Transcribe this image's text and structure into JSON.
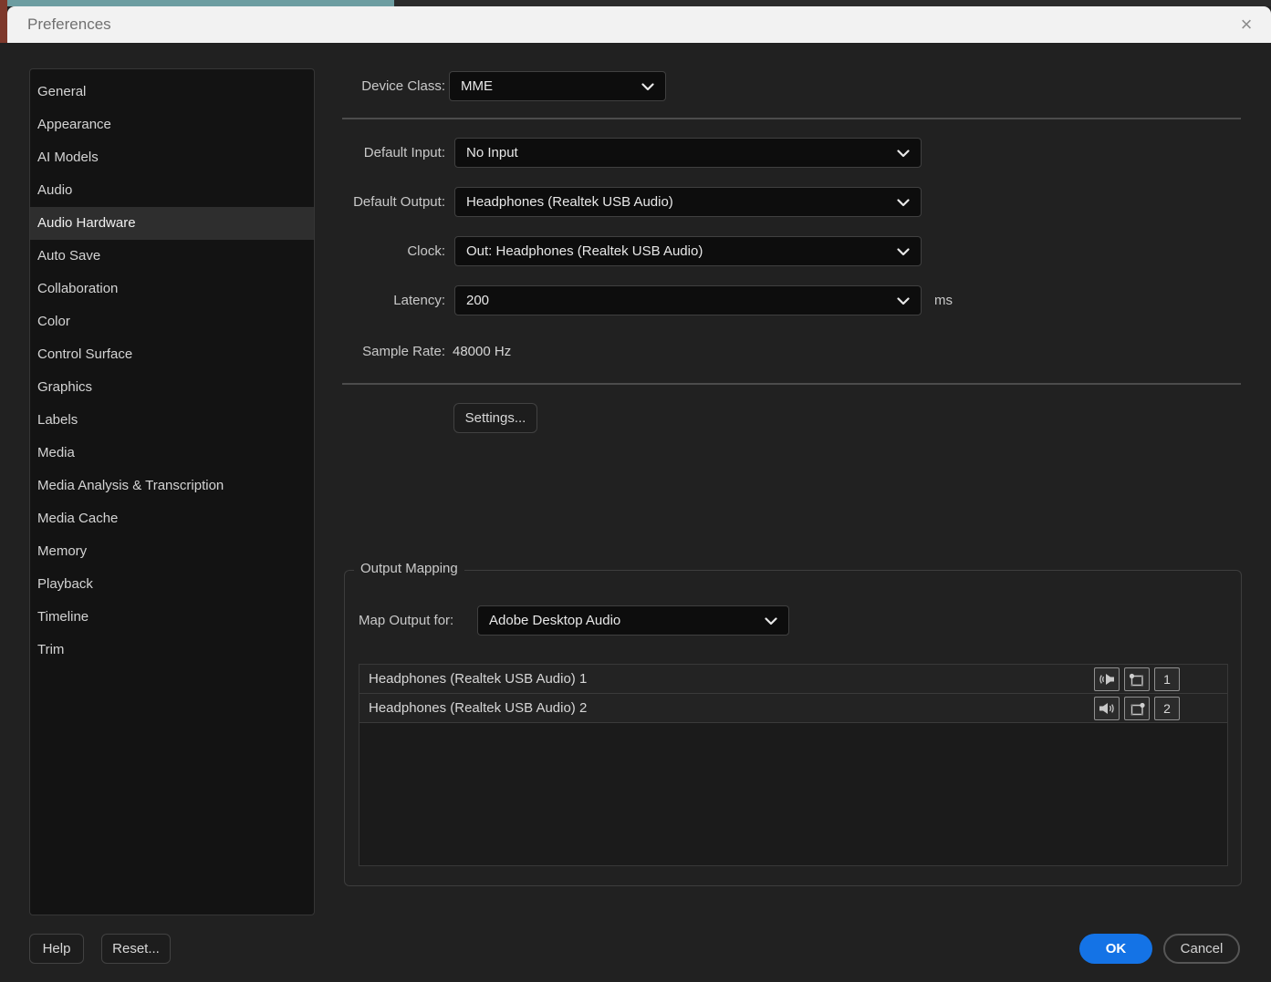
{
  "window": {
    "title": "Preferences",
    "close_glyph": "×"
  },
  "sidebar": {
    "items": [
      {
        "label": "General",
        "selected": false
      },
      {
        "label": "Appearance",
        "selected": false
      },
      {
        "label": "AI Models",
        "selected": false
      },
      {
        "label": "Audio",
        "selected": false
      },
      {
        "label": "Audio Hardware",
        "selected": true
      },
      {
        "label": "Auto Save",
        "selected": false
      },
      {
        "label": "Collaboration",
        "selected": false
      },
      {
        "label": "Color",
        "selected": false
      },
      {
        "label": "Control Surface",
        "selected": false
      },
      {
        "label": "Graphics",
        "selected": false
      },
      {
        "label": "Labels",
        "selected": false
      },
      {
        "label": "Media",
        "selected": false
      },
      {
        "label": "Media Analysis & Transcription",
        "selected": false
      },
      {
        "label": "Media Cache",
        "selected": false
      },
      {
        "label": "Memory",
        "selected": false
      },
      {
        "label": "Playback",
        "selected": false
      },
      {
        "label": "Timeline",
        "selected": false
      },
      {
        "label": "Trim",
        "selected": false
      }
    ]
  },
  "form": {
    "device_class": {
      "label": "Device Class:",
      "value": "MME"
    },
    "default_input": {
      "label": "Default Input:",
      "value": "No Input"
    },
    "default_output": {
      "label": "Default Output:",
      "value": "Headphones (Realtek USB Audio)"
    },
    "clock": {
      "label": "Clock:",
      "value": "Out: Headphones (Realtek USB Audio)"
    },
    "latency": {
      "label": "Latency:",
      "value": "200",
      "unit": "ms"
    },
    "sample_rate": {
      "label": "Sample Rate:",
      "value": "48000 Hz"
    },
    "settings_button": "Settings..."
  },
  "output_mapping": {
    "legend": "Output Mapping",
    "map_output_for": {
      "label": "Map Output for:",
      "value": "Adobe Desktop Audio"
    },
    "rows": [
      {
        "name": "Headphones (Realtek USB Audio) 1",
        "speaker_icon": "speaker-left",
        "grid_icon": "grid-dot-top-left",
        "channel": "1"
      },
      {
        "name": "Headphones (Realtek USB Audio) 2",
        "speaker_icon": "speaker-right",
        "grid_icon": "grid-dot-top-right",
        "channel": "2"
      }
    ]
  },
  "footer": {
    "help": "Help",
    "reset": "Reset...",
    "ok": "OK",
    "cancel": "Cancel"
  },
  "colors": {
    "accent_blue": "#1473e6",
    "strip_teal": "#6d9da1",
    "strip_red": "#7e392c",
    "strip_dark": "#2b2b2b",
    "dialog_bg": "#212121",
    "titlebar_bg": "#f2f2f2"
  }
}
